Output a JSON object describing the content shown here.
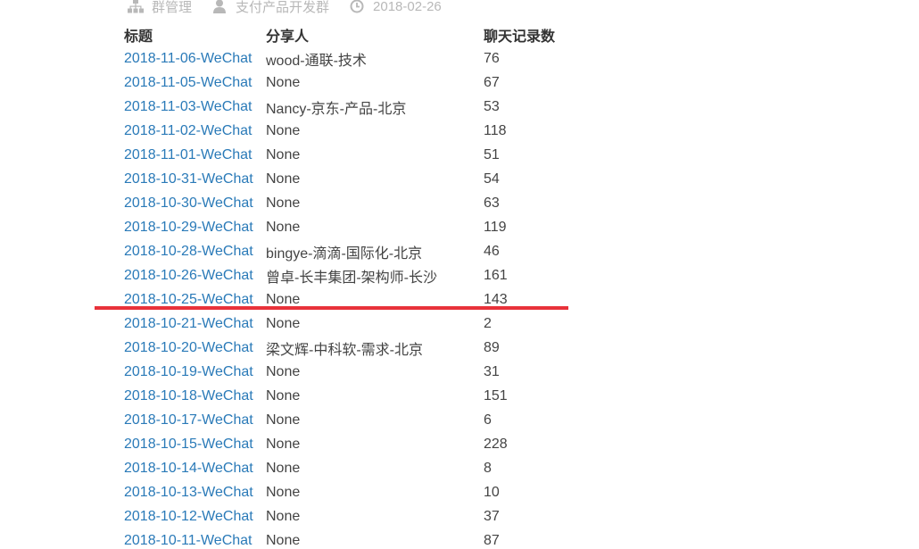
{
  "meta": {
    "group_label": "群管理",
    "group_name": "支付产品开发群",
    "date": "2018-02-26"
  },
  "table": {
    "headers": {
      "title": "标题",
      "sharer": "分享人",
      "count": "聊天记录数"
    },
    "rows": [
      {
        "title": "2018-11-06-WeChat",
        "sharer": "wood-通联-技术",
        "count": "76"
      },
      {
        "title": "2018-11-05-WeChat",
        "sharer": "None",
        "count": "67"
      },
      {
        "title": "2018-11-03-WeChat",
        "sharer": "Nancy-京东-产品-北京",
        "count": "53"
      },
      {
        "title": "2018-11-02-WeChat",
        "sharer": "None",
        "count": "118"
      },
      {
        "title": "2018-11-01-WeChat",
        "sharer": "None",
        "count": "51"
      },
      {
        "title": "2018-10-31-WeChat",
        "sharer": "None",
        "count": "54"
      },
      {
        "title": "2018-10-30-WeChat",
        "sharer": "None",
        "count": "63"
      },
      {
        "title": "2018-10-29-WeChat",
        "sharer": "None",
        "count": "119"
      },
      {
        "title": "2018-10-28-WeChat",
        "sharer": "bingye-滴滴-国际化-北京",
        "count": "46"
      },
      {
        "title": "2018-10-26-WeChat",
        "sharer": "曾卓-长丰集团-架构师-长沙",
        "count": "161"
      },
      {
        "title": "2018-10-25-WeChat",
        "sharer": "None",
        "count": "143"
      },
      {
        "title": "2018-10-21-WeChat",
        "sharer": "None",
        "count": "2"
      },
      {
        "title": "2018-10-20-WeChat",
        "sharer": "梁文辉-中科软-需求-北京",
        "count": "89"
      },
      {
        "title": "2018-10-19-WeChat",
        "sharer": "None",
        "count": "31"
      },
      {
        "title": "2018-10-18-WeChat",
        "sharer": "None",
        "count": "151"
      },
      {
        "title": "2018-10-17-WeChat",
        "sharer": "None",
        "count": "6"
      },
      {
        "title": "2018-10-15-WeChat",
        "sharer": "None",
        "count": "228"
      },
      {
        "title": "2018-10-14-WeChat",
        "sharer": "None",
        "count": "8"
      },
      {
        "title": "2018-10-13-WeChat",
        "sharer": "None",
        "count": "10"
      },
      {
        "title": "2018-10-12-WeChat",
        "sharer": "None",
        "count": "37"
      },
      {
        "title": "2018-10-11-WeChat",
        "sharer": "None",
        "count": "87"
      }
    ]
  },
  "colors": {
    "link": "#2a7ab8",
    "highlight_line": "#e8323a",
    "meta_text": "#b8b8b8"
  },
  "icons": {
    "group": "sitemap-icon",
    "group_name": "user-icon",
    "date": "clock-icon"
  }
}
